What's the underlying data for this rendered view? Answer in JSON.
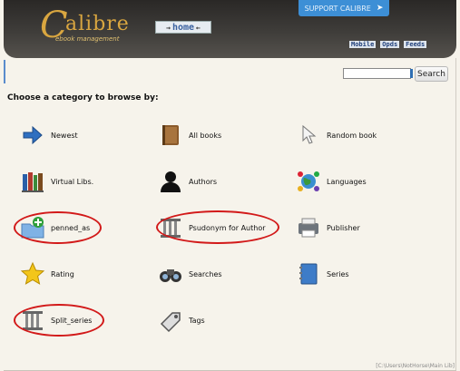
{
  "header": {
    "logo_letter": "C",
    "logo_word": "alibre",
    "logo_sub": "ebook management",
    "home_label": "home",
    "support_label": "SUPPORT CALIBRE",
    "support_icon": "plus",
    "links": [
      "Mobile",
      "Opds",
      "Feeds"
    ],
    "bg_color": "#3f3d3a",
    "accent_color": "#d9a640"
  },
  "search": {
    "value": "",
    "button_label": "Search"
  },
  "prompt": "Choose a category to browse by:",
  "categories": [
    {
      "label": "Newest",
      "icon": "arrow-right-icon",
      "circled": false
    },
    {
      "label": "All books",
      "icon": "book-icon",
      "circled": false
    },
    {
      "label": "Random book",
      "icon": "cursor-icon",
      "circled": false
    },
    {
      "label": "Virtual Libs.",
      "icon": "bookshelf-icon",
      "circled": false
    },
    {
      "label": "Authors",
      "icon": "person-icon",
      "circled": false
    },
    {
      "label": "Languages",
      "icon": "globe-icon",
      "circled": false
    },
    {
      "label": "penned_as",
      "icon": "folder-add-icon",
      "circled": true
    },
    {
      "label": "Psudonym for Author",
      "icon": "column-icon",
      "circled": true
    },
    {
      "label": "Publisher",
      "icon": "printer-icon",
      "circled": false
    },
    {
      "label": "Rating",
      "icon": "star-icon",
      "circled": false
    },
    {
      "label": "Searches",
      "icon": "binoculars-icon",
      "circled": false
    },
    {
      "label": "Series",
      "icon": "notebook-icon",
      "circled": false
    },
    {
      "label": "Split_series",
      "icon": "column-icon",
      "circled": true
    },
    {
      "label": "Tags",
      "icon": "tag-icon",
      "circled": false
    }
  ],
  "footer": "[C:\\Users\\NotHorse\\Main Lib]",
  "highlight_color": "#d21919"
}
